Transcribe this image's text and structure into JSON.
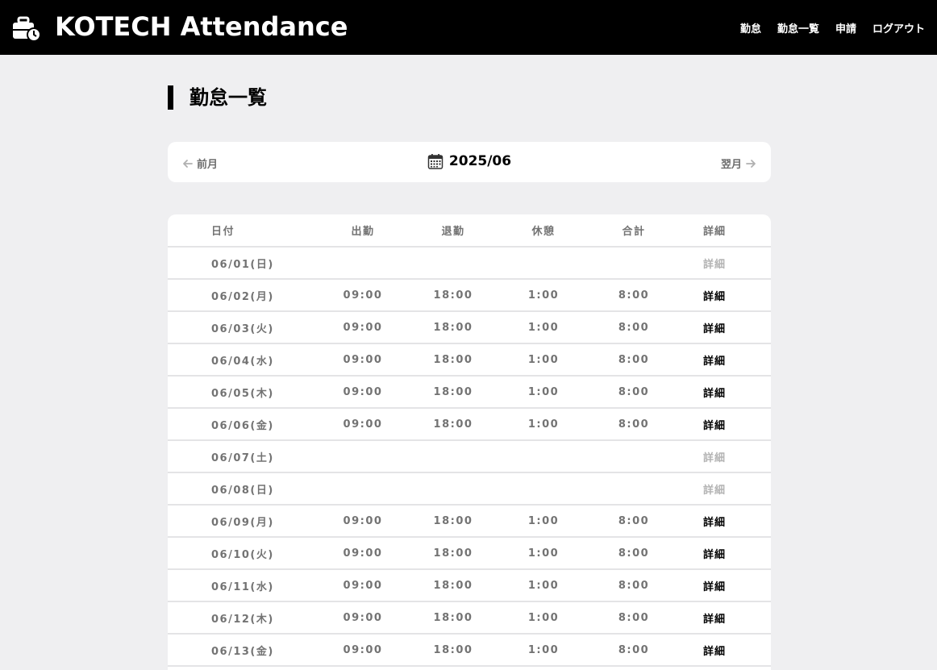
{
  "header": {
    "brand": "KOTECH Attendance",
    "logo_icon": "briefcase-clock-icon",
    "nav": [
      "勤怠",
      "勤怠一覧",
      "申請",
      "ログアウト"
    ]
  },
  "page": {
    "title": "勤怠一覧"
  },
  "month_nav": {
    "prev_label": "前月",
    "current": "2025/06",
    "next_label": "翌月",
    "calendar_icon": "calendar-icon"
  },
  "table": {
    "columns": [
      "日付",
      "出勤",
      "退勤",
      "休憩",
      "合計",
      "詳細"
    ],
    "rows": [
      {
        "date": "06/01(日)",
        "in": "",
        "out": "",
        "break": "",
        "total": "",
        "detail": "詳細",
        "enabled": false
      },
      {
        "date": "06/02(月)",
        "in": "09:00",
        "out": "18:00",
        "break": "1:00",
        "total": "8:00",
        "detail": "詳細",
        "enabled": true
      },
      {
        "date": "06/03(火)",
        "in": "09:00",
        "out": "18:00",
        "break": "1:00",
        "total": "8:00",
        "detail": "詳細",
        "enabled": true
      },
      {
        "date": "06/04(水)",
        "in": "09:00",
        "out": "18:00",
        "break": "1:00",
        "total": "8:00",
        "detail": "詳細",
        "enabled": true
      },
      {
        "date": "06/05(木)",
        "in": "09:00",
        "out": "18:00",
        "break": "1:00",
        "total": "8:00",
        "detail": "詳細",
        "enabled": true
      },
      {
        "date": "06/06(金)",
        "in": "09:00",
        "out": "18:00",
        "break": "1:00",
        "total": "8:00",
        "detail": "詳細",
        "enabled": true
      },
      {
        "date": "06/07(土)",
        "in": "",
        "out": "",
        "break": "",
        "total": "",
        "detail": "詳細",
        "enabled": false
      },
      {
        "date": "06/08(日)",
        "in": "",
        "out": "",
        "break": "",
        "total": "",
        "detail": "詳細",
        "enabled": false
      },
      {
        "date": "06/09(月)",
        "in": "09:00",
        "out": "18:00",
        "break": "1:00",
        "total": "8:00",
        "detail": "詳細",
        "enabled": true
      },
      {
        "date": "06/10(火)",
        "in": "09:00",
        "out": "18:00",
        "break": "1:00",
        "total": "8:00",
        "detail": "詳細",
        "enabled": true
      },
      {
        "date": "06/11(水)",
        "in": "09:00",
        "out": "18:00",
        "break": "1:00",
        "total": "8:00",
        "detail": "詳細",
        "enabled": true
      },
      {
        "date": "06/12(木)",
        "in": "09:00",
        "out": "18:00",
        "break": "1:00",
        "total": "8:00",
        "detail": "詳細",
        "enabled": true
      },
      {
        "date": "06/13(金)",
        "in": "09:00",
        "out": "18:00",
        "break": "1:00",
        "total": "8:00",
        "detail": "詳細",
        "enabled": true
      }
    ]
  }
}
